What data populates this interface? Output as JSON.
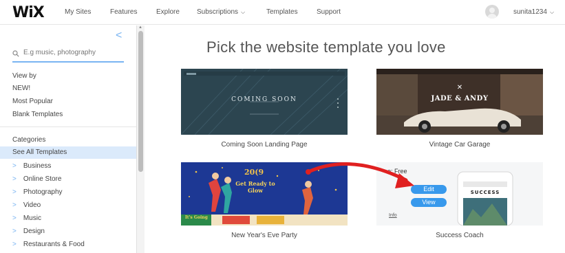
{
  "topbar": {
    "logo": "WiX",
    "nav": [
      "My Sites",
      "Features",
      "Explore",
      "Subscriptions",
      "Templates",
      "Support"
    ],
    "username": "sunita1234"
  },
  "sidebar": {
    "search_placeholder": "E.g music, photography",
    "view_by_title": "View by",
    "view_by": [
      "NEW!",
      "Most Popular",
      "Blank Templates"
    ],
    "categories_title": "Categories",
    "selected_category": "See All Templates",
    "categories": [
      "Business",
      "Online Store",
      "Photography",
      "Video",
      "Music",
      "Design",
      "Restaurants & Food"
    ]
  },
  "main": {
    "headline": "Pick the website template you love",
    "templates": [
      {
        "name": "Coming Soon Landing Page",
        "thumb_text": "COMING SOON"
      },
      {
        "name": "Vintage Car Garage",
        "thumb_text": "JADE & ANDY"
      },
      {
        "name": "New Year's Eve Party",
        "thumb_text": "Get Ready to Glow",
        "thumb_year": "20(9",
        "thumb_footer": "It's Going"
      },
      {
        "name": "Success Coach",
        "price_label": "e: Free",
        "edit_label": "Edit",
        "view_label": "View",
        "info_label": "Info",
        "thumb_text": "SUCCESS"
      }
    ]
  }
}
